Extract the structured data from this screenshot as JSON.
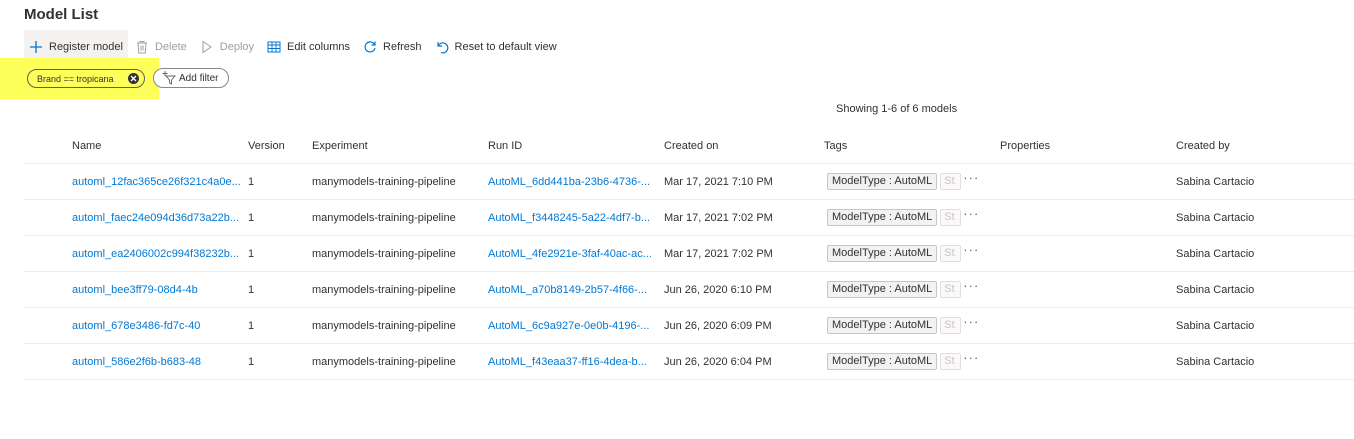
{
  "page": {
    "title": "Model List"
  },
  "toolbar": {
    "register_label": "Register model",
    "delete_label": "Delete",
    "deploy_label": "Deploy",
    "edit_columns_label": "Edit columns",
    "refresh_label": "Refresh",
    "reset_label": "Reset to default view"
  },
  "filters": {
    "active": "Brand == tropicana",
    "add_label": "Add filter",
    "highlight_color": "#ffff5a"
  },
  "summary": {
    "showing": "Showing 1-6 of 6 models"
  },
  "table": {
    "headers": {
      "name": "Name",
      "version": "Version",
      "experiment": "Experiment",
      "run_id": "Run ID",
      "created_on": "Created on",
      "tags": "Tags",
      "properties": "Properties",
      "created_by": "Created by"
    },
    "rows": [
      {
        "name": "automl_12fac365ce26f321c4a0e...",
        "version": "1",
        "experiment": "manymodels-training-pipeline",
        "run_id": "AutoML_6dd441ba-23b6-4736-...",
        "created_on": "Mar 17, 2021 7:10 PM",
        "tag": "ModelType : AutoML",
        "tag2": "St",
        "created_by": "Sabina Cartacio"
      },
      {
        "name": "automl_faec24e094d36d73a22b...",
        "version": "1",
        "experiment": "manymodels-training-pipeline",
        "run_id": "AutoML_f3448245-5a22-4df7-b...",
        "created_on": "Mar 17, 2021 7:02 PM",
        "tag": "ModelType : AutoML",
        "tag2": "St",
        "created_by": "Sabina Cartacio"
      },
      {
        "name": "automl_ea2406002c994f38232b...",
        "version": "1",
        "experiment": "manymodels-training-pipeline",
        "run_id": "AutoML_4fe2921e-3faf-40ac-ac...",
        "created_on": "Mar 17, 2021 7:02 PM",
        "tag": "ModelType : AutoML",
        "tag2": "St",
        "created_by": "Sabina Cartacio"
      },
      {
        "name": "automl_bee3ff79-08d4-4b",
        "version": "1",
        "experiment": "manymodels-training-pipeline",
        "run_id": "AutoML_a70b8149-2b57-4f66-...",
        "created_on": "Jun 26, 2020 6:10 PM",
        "tag": "ModelType : AutoML",
        "tag2": "St",
        "created_by": "Sabina Cartacio"
      },
      {
        "name": "automl_678e3486-fd7c-40",
        "version": "1",
        "experiment": "manymodels-training-pipeline",
        "run_id": "AutoML_6c9a927e-0e0b-4196-...",
        "created_on": "Jun 26, 2020 6:09 PM",
        "tag": "ModelType : AutoML",
        "tag2": "St",
        "created_by": "Sabina Cartacio"
      },
      {
        "name": "automl_586e2f6b-b683-48",
        "version": "1",
        "experiment": "manymodels-training-pipeline",
        "run_id": "AutoML_f43eaa37-ff16-4dea-b...",
        "created_on": "Jun 26, 2020 6:04 PM",
        "tag": "ModelType : AutoML",
        "tag2": "St",
        "created_by": "Sabina Cartacio"
      }
    ],
    "more_glyph": "···"
  },
  "colors": {
    "link": "#0078d4",
    "accent": "#0078d4",
    "text": "#323130"
  }
}
